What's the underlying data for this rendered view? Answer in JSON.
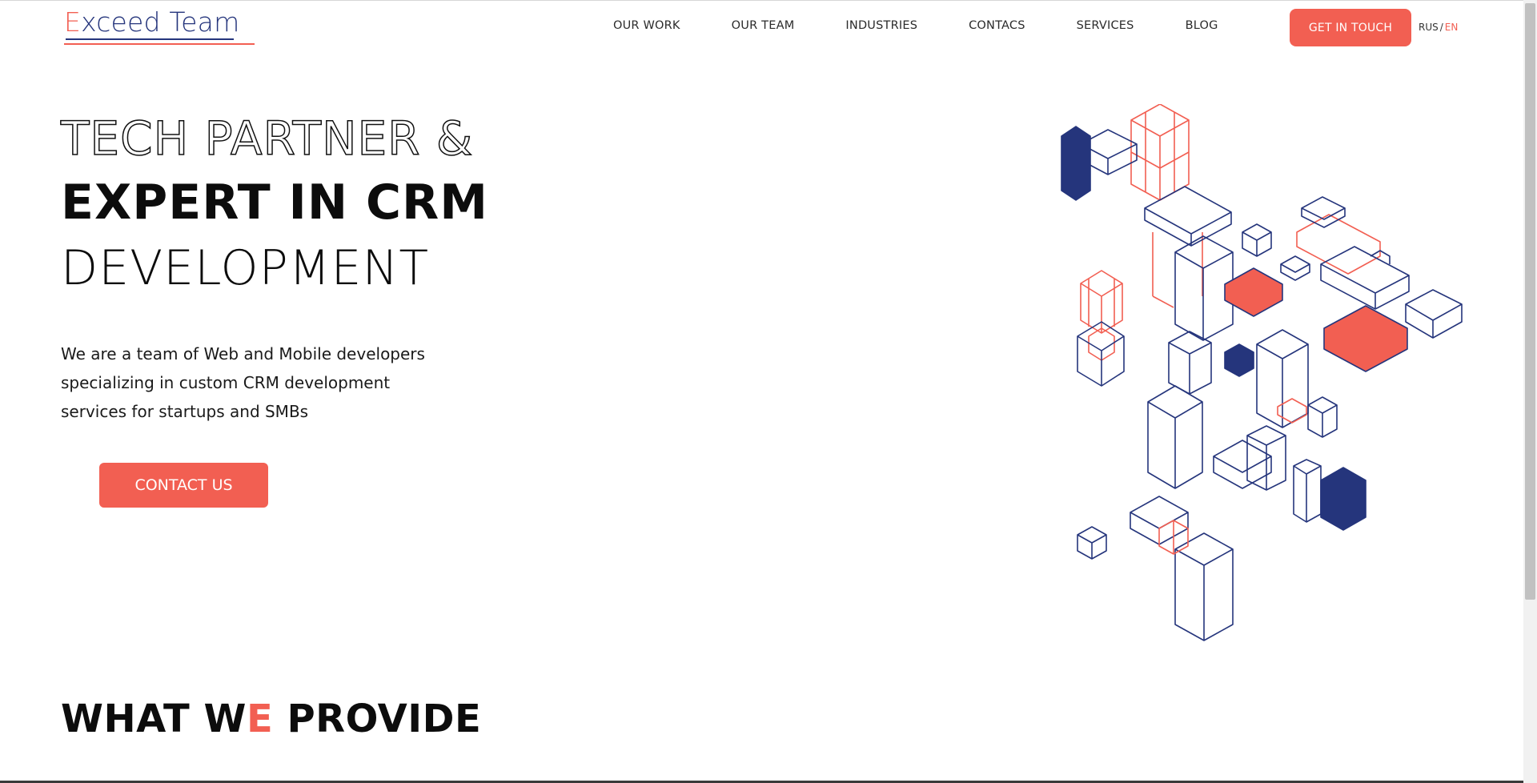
{
  "logo": {
    "first_letter": "E",
    "rest": "xceed Team"
  },
  "nav": {
    "items": [
      "OUR WORK",
      "OUR TEAM",
      "INDUSTRIES",
      "CONTACS",
      "SERVICES",
      "BLOG"
    ],
    "cta": "GET IN TOUCH",
    "lang": {
      "rus": "RUS",
      "sep": "/",
      "en": "EN"
    }
  },
  "hero": {
    "line1": "TECH PARTNER &",
    "line2": "EXPERT IN CRM",
    "line3": "DEVELOPMENT",
    "description": [
      "We are a team of Web and Mobile developers",
      "specializing in custom CRM development",
      "services for startups and SMBs"
    ],
    "cta": "CONTACT US"
  },
  "section": {
    "title_part1": "WHAT W",
    "title_accent": "E",
    "title_part2": " PROVIDE"
  },
  "colors": {
    "accent": "#f25f52",
    "brand_navy": "#25357c"
  }
}
